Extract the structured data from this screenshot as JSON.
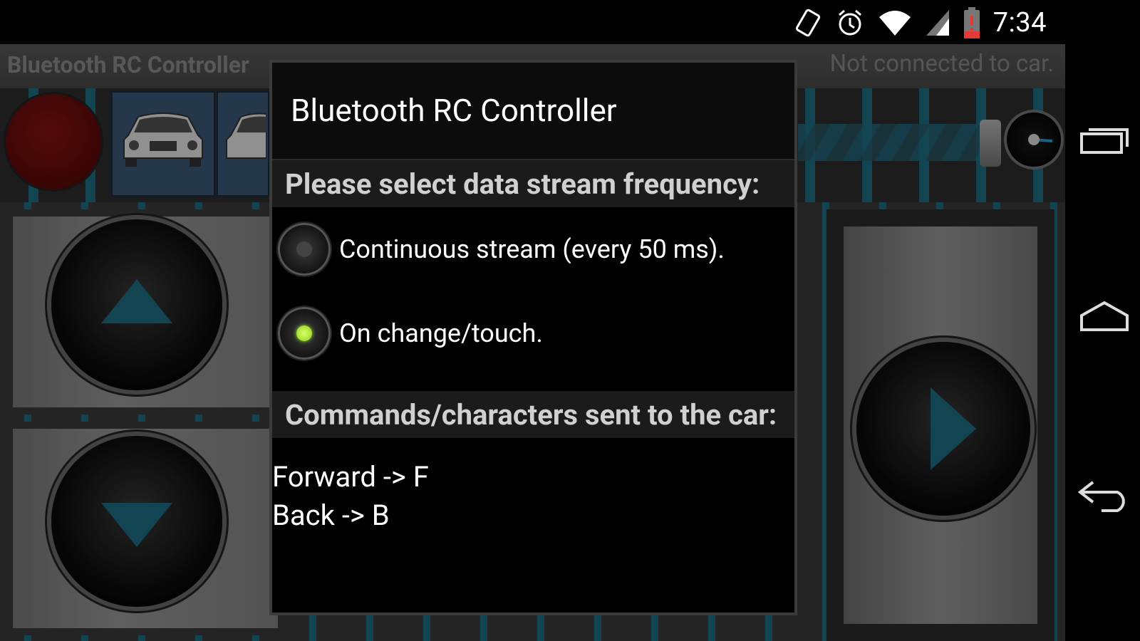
{
  "status_bar": {
    "time": "7:34",
    "icons": [
      "screen-rotation-icon",
      "alarm-icon",
      "wifi-icon",
      "cellular-signal-icon",
      "battery-icon"
    ]
  },
  "app_bar": {
    "title": "Bluetooth RC Controller",
    "connection_status": "Not connected to car."
  },
  "dialog": {
    "title": "Bluetooth RC Controller",
    "frequency_heading": "Please select data stream frequency:",
    "options": [
      {
        "label": "Continuous stream (every 50 ms).",
        "selected": false
      },
      {
        "label": "On change/touch.",
        "selected": true
      }
    ],
    "commands_heading": "Commands/characters sent to the car:",
    "commands": [
      "Forward -> F",
      "Back -> B"
    ]
  },
  "navigation": [
    "recent-apps-icon",
    "home-icon",
    "back-icon"
  ],
  "colors": {
    "accent_blue": "#1f6e85",
    "radio_selected": "#9be22b",
    "record_red": "#8a1212"
  }
}
